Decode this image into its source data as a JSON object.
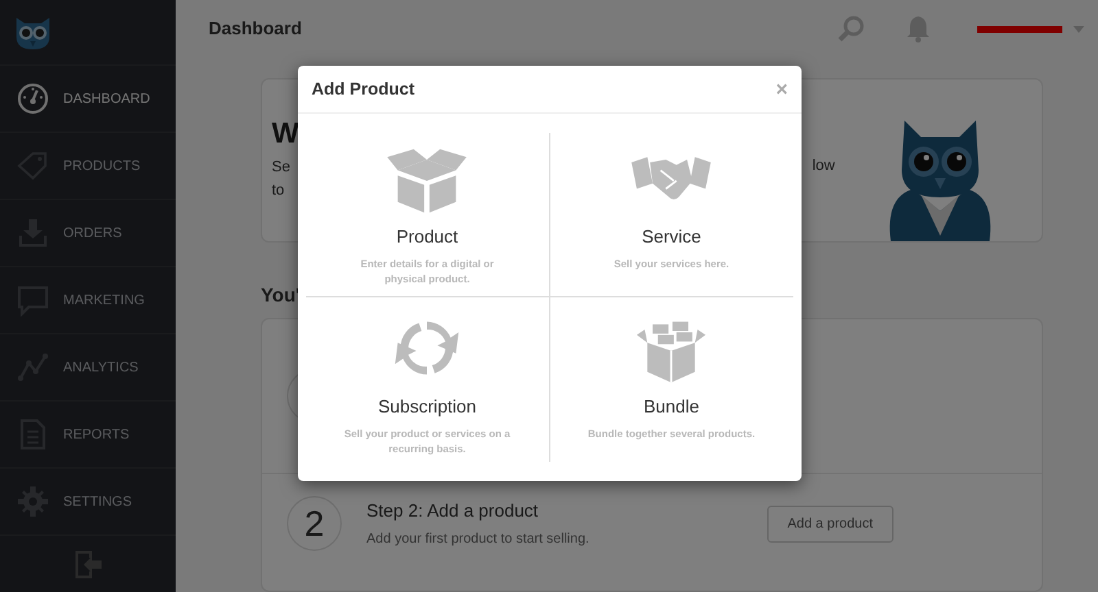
{
  "sidebar": {
    "items": [
      {
        "kind": "gauge",
        "label": "DASHBOARD",
        "selected": true
      },
      {
        "kind": "tag",
        "label": "PRODUCTS",
        "selected": false
      },
      {
        "kind": "download",
        "label": "ORDERS",
        "selected": false
      },
      {
        "kind": "chat",
        "label": "MARKETING",
        "selected": false
      },
      {
        "kind": "chart",
        "label": "ANALYTICS",
        "selected": false
      },
      {
        "kind": "document",
        "label": "REPORTS",
        "selected": false
      },
      {
        "kind": "gear",
        "label": "SETTINGS",
        "selected": false
      }
    ]
  },
  "header": {
    "title": "Dashboard"
  },
  "welcome_card": {
    "title": "W",
    "text_left": [
      "Se",
      "to"
    ],
    "text_right": "low"
  },
  "section_title": "You'",
  "steps": [
    {
      "number": "2",
      "title": "Step 2: Add a product",
      "text": "Add your first product to start selling.",
      "button": "Add a product"
    }
  ],
  "modal": {
    "title": "Add Product",
    "close": "×",
    "options": [
      {
        "kind": "box",
        "title": "Product",
        "description": "Enter details for a digital or physical product."
      },
      {
        "kind": "handshake",
        "title": "Service",
        "description": "Sell your services here."
      },
      {
        "kind": "cycle",
        "title": "Subscription",
        "description": "Sell your product or services on a recurring basis."
      },
      {
        "kind": "bundle",
        "title": "Bundle",
        "description": "Bundle together several products."
      }
    ]
  }
}
